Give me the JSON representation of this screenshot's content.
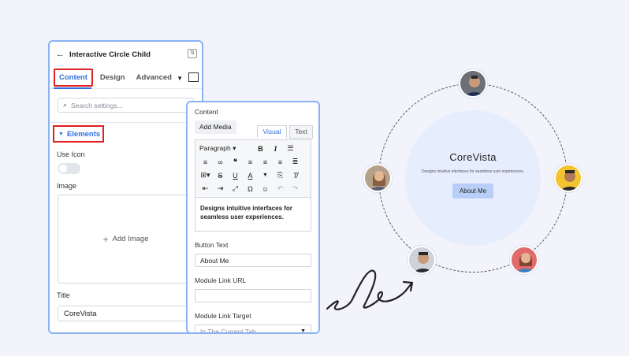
{
  "left_panel": {
    "back_icon": "arrow-left-icon",
    "title": "Interactive Circle Child",
    "tabs": [
      {
        "label": "Content",
        "active": true
      },
      {
        "label": "Design",
        "active": false
      },
      {
        "label": "Advanced",
        "active": false
      }
    ],
    "search_placeholder": "Search settings...",
    "section_label": "Elements",
    "use_icon_label": "Use Icon",
    "use_icon_on": false,
    "image_label": "Image",
    "add_image_label": "Add Image",
    "title_label": "Title",
    "title_value": "CoreVista"
  },
  "right_panel": {
    "content_label": "Content",
    "add_media_label": "Add Media",
    "visual_tab": "Visual",
    "text_tab": "Text",
    "paragraph_format": "Paragraph",
    "body_text": "Designs intuitive interfaces for seamless user experiences.",
    "button_text_label": "Button Text",
    "button_text_value": "About Me",
    "link_url_label": "Module Link URL",
    "link_url_value": "",
    "link_target_label": "Module Link Target",
    "link_target_value": "In The Current Tab"
  },
  "preview": {
    "brand": "CoreVista",
    "tagline": "Designs intuitive interfaces for seamless user experiences.",
    "button_label": "About Me"
  },
  "colors": {
    "accent": "#2f6fe0",
    "highlight": "#e02020",
    "panel_border": "#8bb2f5",
    "core_bg": "#e6edfd",
    "button_bg": "#b8cef8"
  }
}
